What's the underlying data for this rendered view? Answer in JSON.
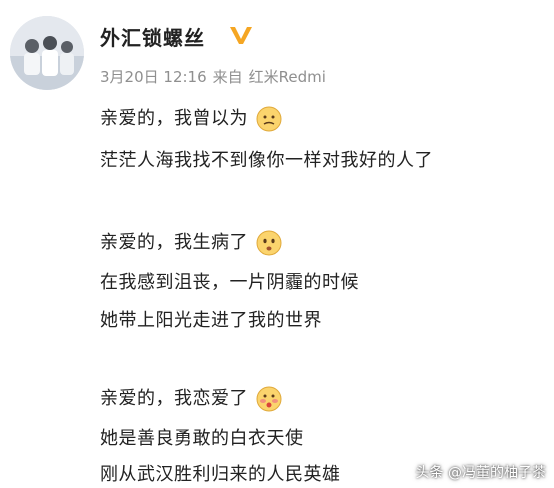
{
  "post": {
    "username": "外汇锁螺丝",
    "date": "3月20日 12:16",
    "source_prefix": "来自",
    "device": "红米Redmi",
    "paragraphs": [
      {
        "lines": [
          "亲爱的，我曾以为",
          "茫茫人海我找不到像你一样对我好的人了"
        ],
        "emoji": "thinking-face-icon"
      },
      {
        "lines": [
          "亲爱的，我生病了",
          "在我感到沮丧，一片阴霾的时候",
          "她带上阳光走进了我的世界"
        ],
        "emoji": "sick-face-icon"
      },
      {
        "lines": [
          "亲爱的，我恋爱了",
          "她是善良勇敢的白衣天使",
          "刚从武汉胜利归来的人民英雄"
        ],
        "emoji": "blushing-face-icon"
      }
    ]
  },
  "watermark": "头条 @冯董的柚子茶",
  "colors": {
    "verified": "#f5a623",
    "meta": "#8f8f8f",
    "text": "#222222"
  }
}
